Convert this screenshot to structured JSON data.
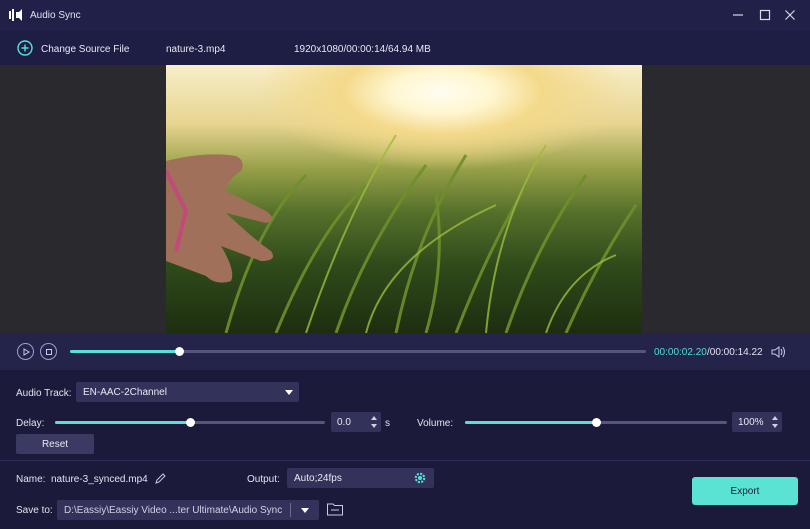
{
  "window": {
    "title": "Audio Sync"
  },
  "source": {
    "change_label": "Change Source File",
    "file_name": "nature-3.mp4",
    "file_info": "1920x1080/00:00:14/64.94 MB"
  },
  "playback": {
    "current_time": "00:00:02.20",
    "total_time": "/00:00:14.22",
    "progress": 0.19
  },
  "audio_track": {
    "label": "Audio Track:",
    "value": "EN-AAC-2Channel"
  },
  "delay": {
    "label": "Delay:",
    "value": "0.0",
    "unit": "s",
    "slider_fraction": 0.5
  },
  "volume": {
    "label": "Volume:",
    "value": "100%",
    "slider_fraction": 0.5
  },
  "reset_label": "Reset",
  "output_settings": {
    "name_label": "Name:",
    "name_value": "nature-3_synced.mp4",
    "output_label": "Output:",
    "output_value": "Auto;24fps",
    "save_label": "Save to:",
    "save_path": "D:\\Eassiy\\Eassiy Video ...ter Ultimate\\Audio Sync"
  },
  "export_label": "Export",
  "colors": {
    "accent": "#58e1d6",
    "background": "#1b1a3a"
  }
}
